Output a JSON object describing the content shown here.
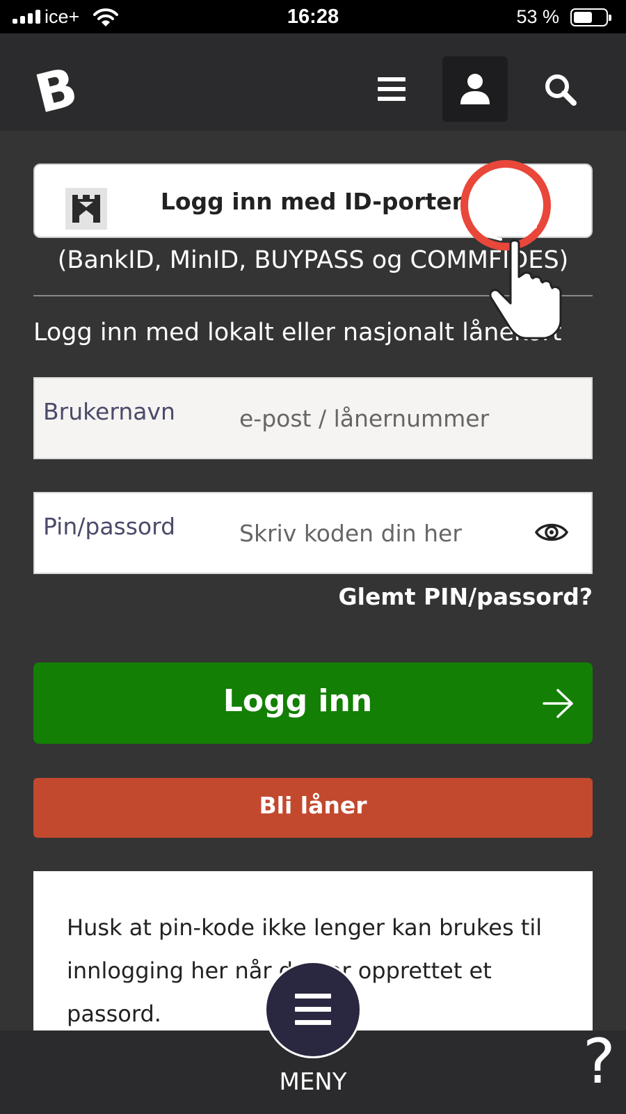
{
  "status_bar": {
    "carrier": "ice+",
    "time": "16:28",
    "battery": "53 %",
    "battery_level": 0.53
  },
  "header": {
    "logo": "B",
    "icons": [
      "hamburger-menu-icon",
      "user-icon",
      "search-icon"
    ],
    "active": "user-icon"
  },
  "idporten": {
    "label": "Logg inn med ID-porten",
    "subtitle": "(BankID, MinID, BUYPASS og COMMFIDES)",
    "icon": "castle-icon"
  },
  "local_login": {
    "heading": "Logg inn med lokalt eller nasjonalt lånekort"
  },
  "username": {
    "label": "Brukernavn",
    "placeholder": "e-post / lånernummer",
    "value": ""
  },
  "password": {
    "label": "Pin/passord",
    "placeholder": "Skriv koden din her",
    "value": ""
  },
  "forgot_link": "Glemt PIN/passord?",
  "login_button": "Logg inn",
  "register_button": "Bli låner",
  "notice": "Husk at pin-kode ikke lenger kan brukes til innlogging her når du har opprettet et passord.",
  "bottom_bar": {
    "menu_label": "MENY",
    "help": "?"
  },
  "colors": {
    "background": "#343434",
    "header": "#2b2b2d",
    "login_green": "#137f04",
    "register_red": "#c2492e",
    "tap_indicator": "#e9473a",
    "menu_fab": "#2a2740"
  }
}
